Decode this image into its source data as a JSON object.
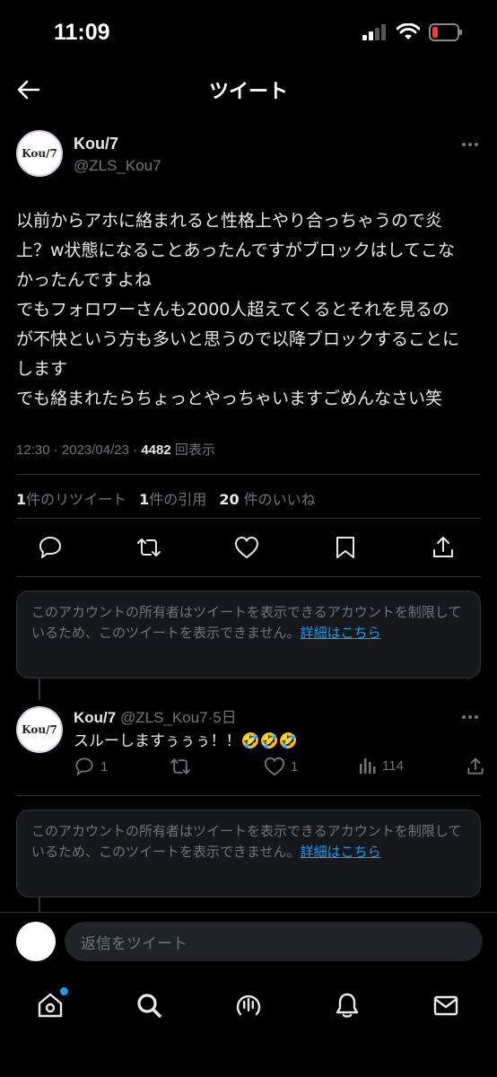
{
  "status_bar": {
    "time": "11:09"
  },
  "nav": {
    "title": "ツイート"
  },
  "tweet": {
    "author_name": "Kou/7",
    "handle": "@ZLS_Kou7",
    "avatar_text": "Kou/7",
    "text_lines": [
      "以前からアホに絡まれると性格上やり合っちゃうので炎",
      "上？w状態になることあったんですがブロックはしてこな",
      "かったんですよね",
      "でもフォロワーさんも2000人超えてくるとそれを見るの",
      "が不快という方も多いと思うので以降ブロックすることに",
      "します",
      "でも絡まれたらちょっとやっちゃいますごめんなさい笑"
    ],
    "time": "12:30",
    "date": "2023/04/23",
    "views_count": "4482",
    "views_label": "回表示",
    "retweets_count": "1",
    "retweets_label": "件のリツイート",
    "quotes_count": "1",
    "quotes_label": "件の引用",
    "likes_count": "20",
    "likes_label": "件のいいね"
  },
  "notice": {
    "text": "このアカウントの所有者はツイートを表示できるアカウントを制限しているため、このツイートを表示できません。",
    "link": "詳細はこちら"
  },
  "reply": {
    "author_name": "Kou/7",
    "handle": "@ZLS_Kou7",
    "time_ago": "5日",
    "text": "スルーしますぅぅぅ！！🤣🤣🤣",
    "avatar_text": "Kou/7",
    "reply_count": "1",
    "like_count": "1",
    "views_count": "114"
  },
  "reply_bar": {
    "placeholder": "返信をツイート"
  },
  "colors": {
    "background": "#000000",
    "accent": "#1d9bf0",
    "secondary_text": "#71767b",
    "notice_bg": "#16181c",
    "battery_low": "#ff3b30"
  }
}
